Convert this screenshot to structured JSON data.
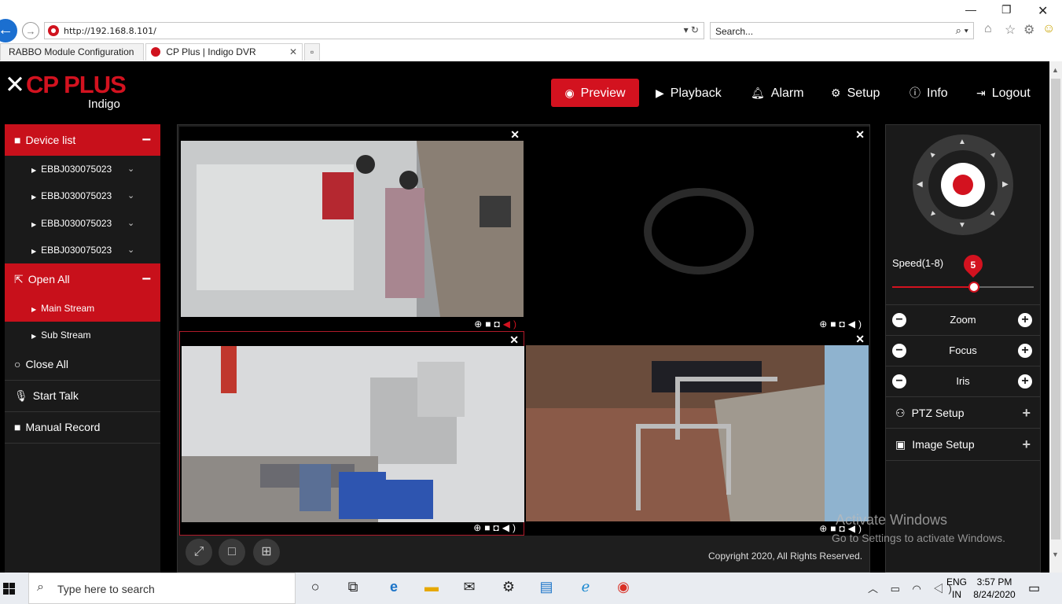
{
  "browser": {
    "url": "http://192.168.8.101/",
    "search_placeholder": "Search...",
    "tabs": [
      {
        "label": "RABBO Module Configuration"
      },
      {
        "label": "CP Plus | Indigo DVR"
      }
    ]
  },
  "app": {
    "logo": {
      "brand": "CP PLUS",
      "sub": "Indigo"
    },
    "nav": [
      {
        "label": "Preview",
        "icon": "eye-icon"
      },
      {
        "label": "Playback",
        "icon": "play-circle-icon"
      },
      {
        "label": "Alarm",
        "icon": "bell-icon"
      },
      {
        "label": "Setup",
        "icon": "gear-icon"
      },
      {
        "label": "Info",
        "icon": "info-icon"
      },
      {
        "label": "Logout",
        "icon": "logout-icon"
      }
    ],
    "sidebar": {
      "device_list": "Device list",
      "devices": [
        "EBBJ030075023",
        "EBBJ030075023",
        "EBBJ030075023",
        "EBBJ030075023"
      ],
      "open_all": "Open All",
      "streams": [
        "Main Stream",
        "Sub Stream"
      ],
      "close_all": "Close All",
      "start_talk": "Start Talk",
      "manual_record": "Manual Record"
    },
    "copyright": "Copyright 2020, All Rights Reserved.",
    "ptz": {
      "speed_label": "Speed(1-8)",
      "speed_value": "5",
      "speed_min": 1,
      "speed_max": 8,
      "zoom": "Zoom",
      "focus": "Focus",
      "iris": "Iris",
      "ptz_setup": "PTZ Setup",
      "image_setup": "Image Setup"
    },
    "accent": "#d3121f"
  },
  "watermark": {
    "line1": "Activate Windows",
    "line2": "Go to Settings to activate Windows."
  },
  "taskbar": {
    "search_placeholder": "Type here to search",
    "lang_top": "ENG",
    "lang_bottom": "IN",
    "time": "3:57 PM",
    "date": "8/24/2020"
  }
}
